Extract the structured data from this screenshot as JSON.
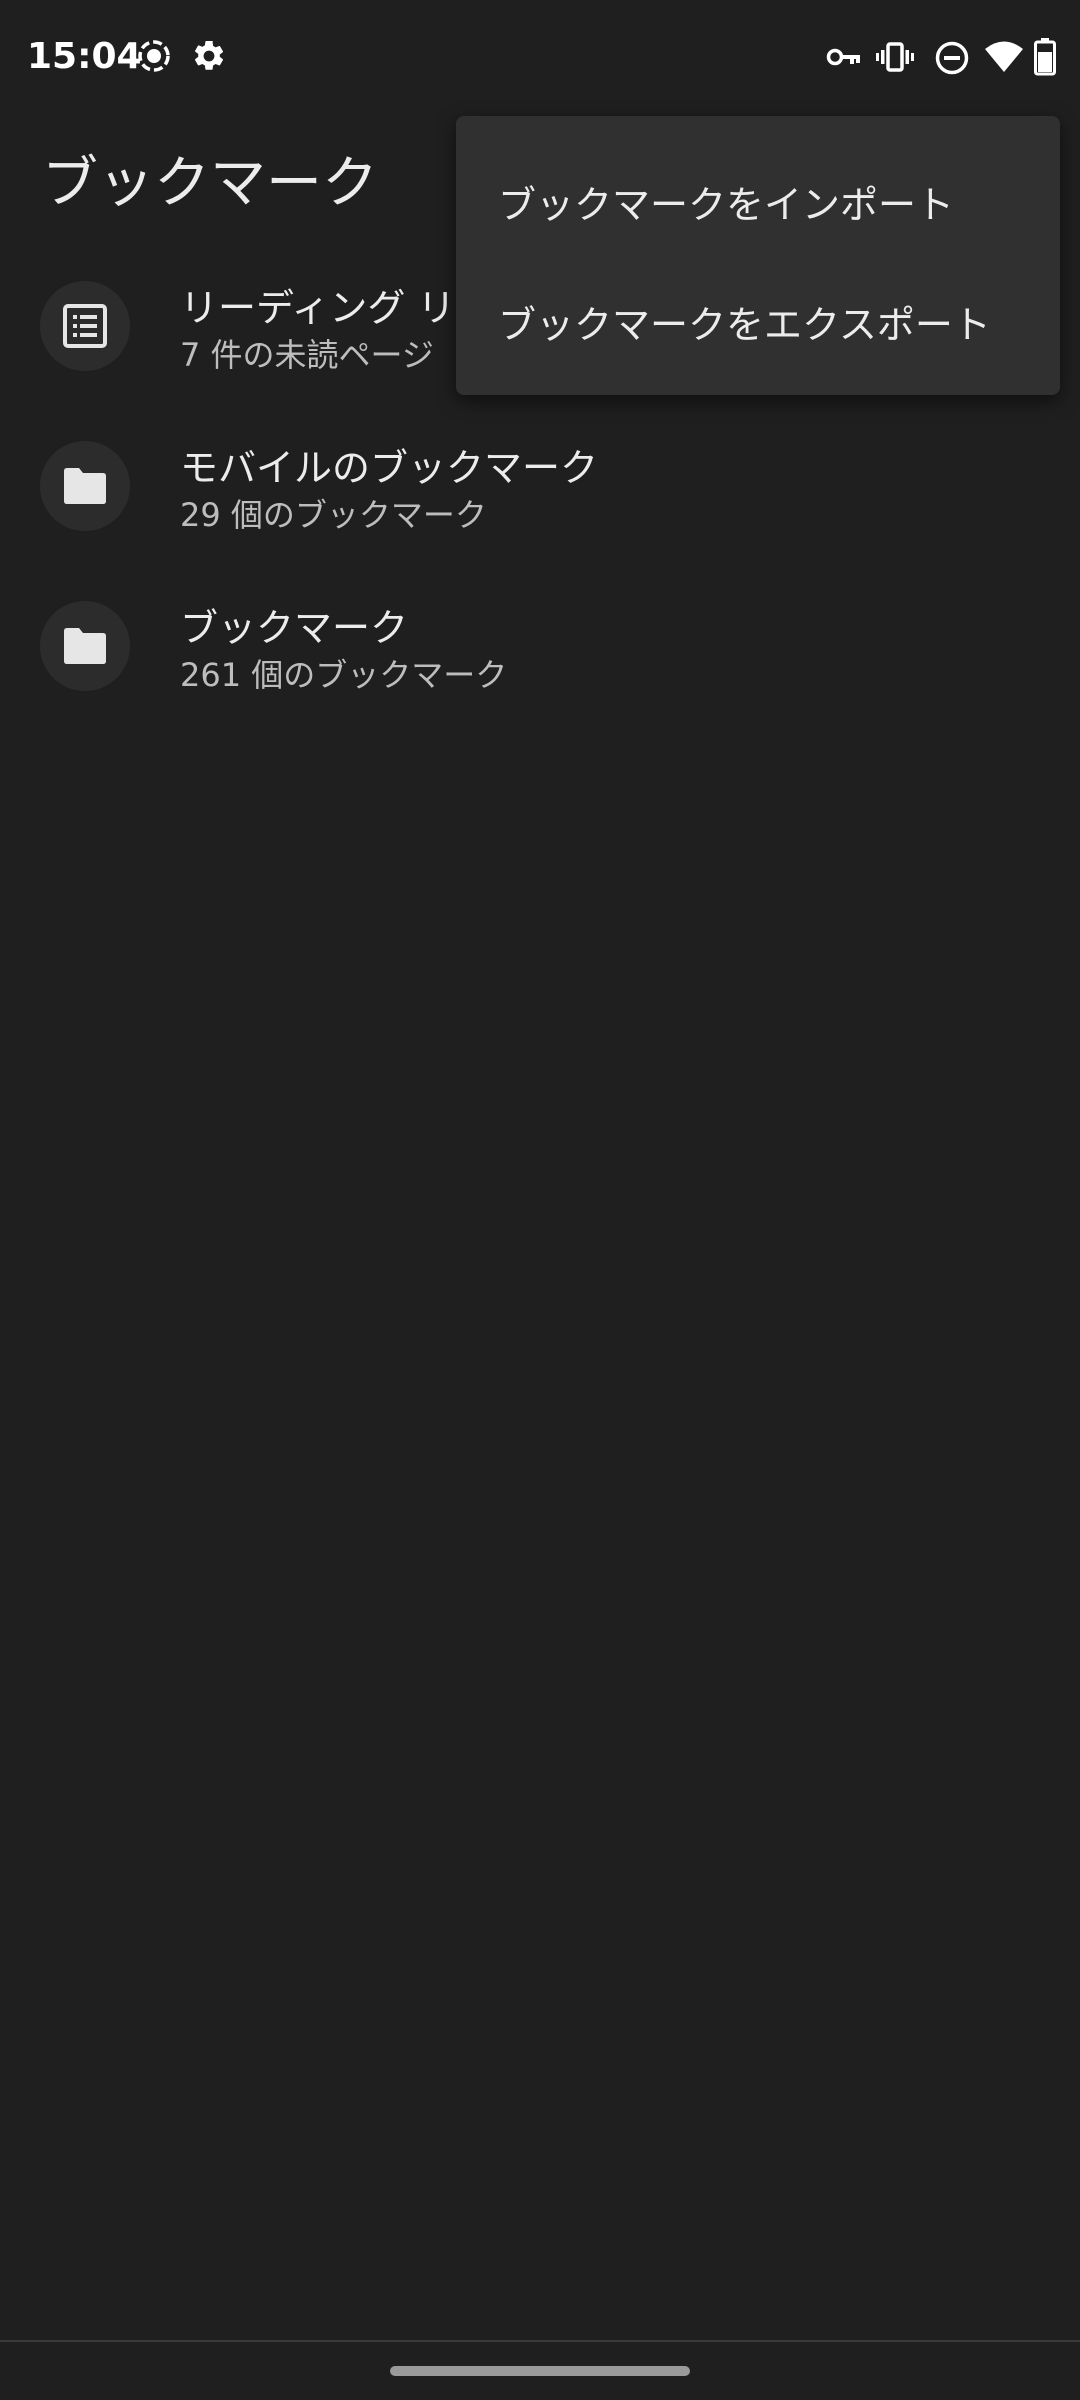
{
  "status_bar": {
    "time": "15:04",
    "left_icons": [
      "screen-record-icon",
      "settings-gear-icon"
    ],
    "right_icons": [
      "vpn-key-icon",
      "vibrate-icon",
      "do-not-disturb-icon",
      "wifi-icon",
      "battery-icon"
    ]
  },
  "header": {
    "title": "ブックマーク"
  },
  "list": {
    "items": [
      {
        "icon": "reading-list-icon",
        "title": "リーディング リ",
        "subtitle": "7 件の未読ページ"
      },
      {
        "icon": "folder-icon",
        "title": "モバイルのブックマーク",
        "subtitle": "29 個のブックマーク"
      },
      {
        "icon": "folder-icon",
        "title": "ブックマーク",
        "subtitle": "261 個のブックマーク"
      }
    ]
  },
  "menu": {
    "items": [
      {
        "label": "ブックマークをインポート"
      },
      {
        "label": "ブックマークをエクスポート"
      }
    ]
  },
  "colors": {
    "background": "#1f1f1f",
    "menu_background": "#303030",
    "icon_circle": "#2c2c2c",
    "text_primary": "#ececec",
    "text_secondary": "#bdbdbd"
  }
}
